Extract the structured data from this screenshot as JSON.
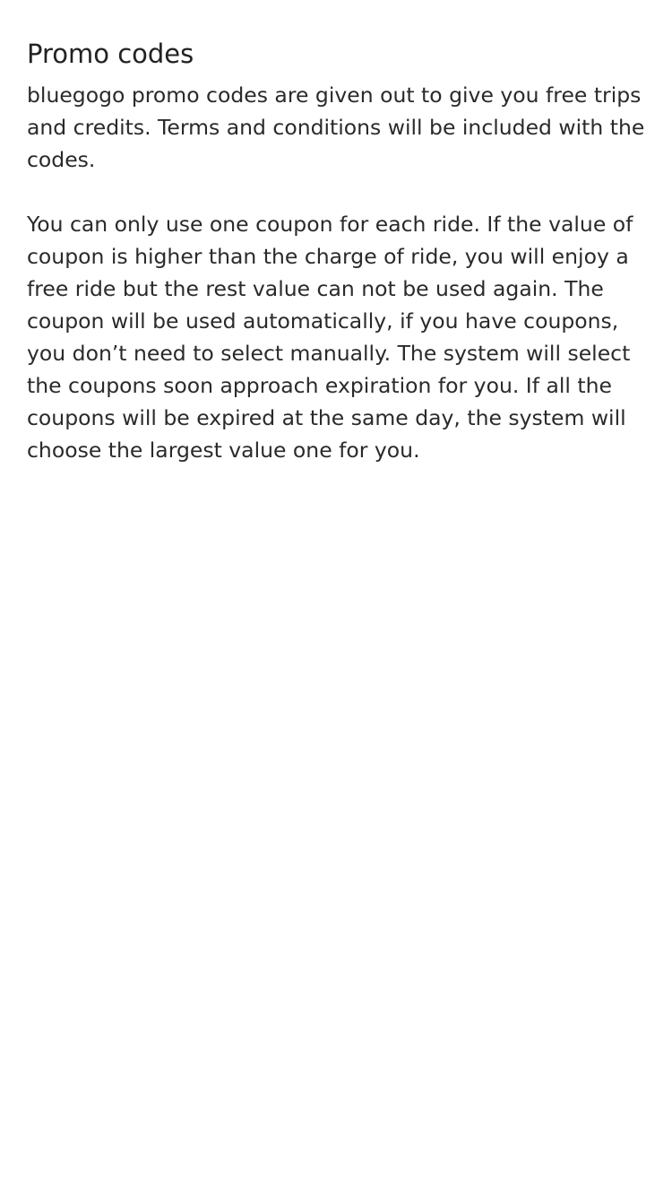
{
  "page": {
    "title": "Promo codes",
    "paragraphs": [
      "bluegogo promo codes are given out to give you free trips and credits. Terms and conditions will be included with the codes.",
      "You can only use one coupon for each ride. If the value of coupon is higher than the charge of ride, you will enjoy a free ride but the rest value can not be used again. The coupon will be used automatically, if you have coupons, you don’t need to select manually. The system will select the coupons soon approach expiration for you. If all the coupons will be expired at the same day, the system will choose the largest value one for you."
    ]
  }
}
